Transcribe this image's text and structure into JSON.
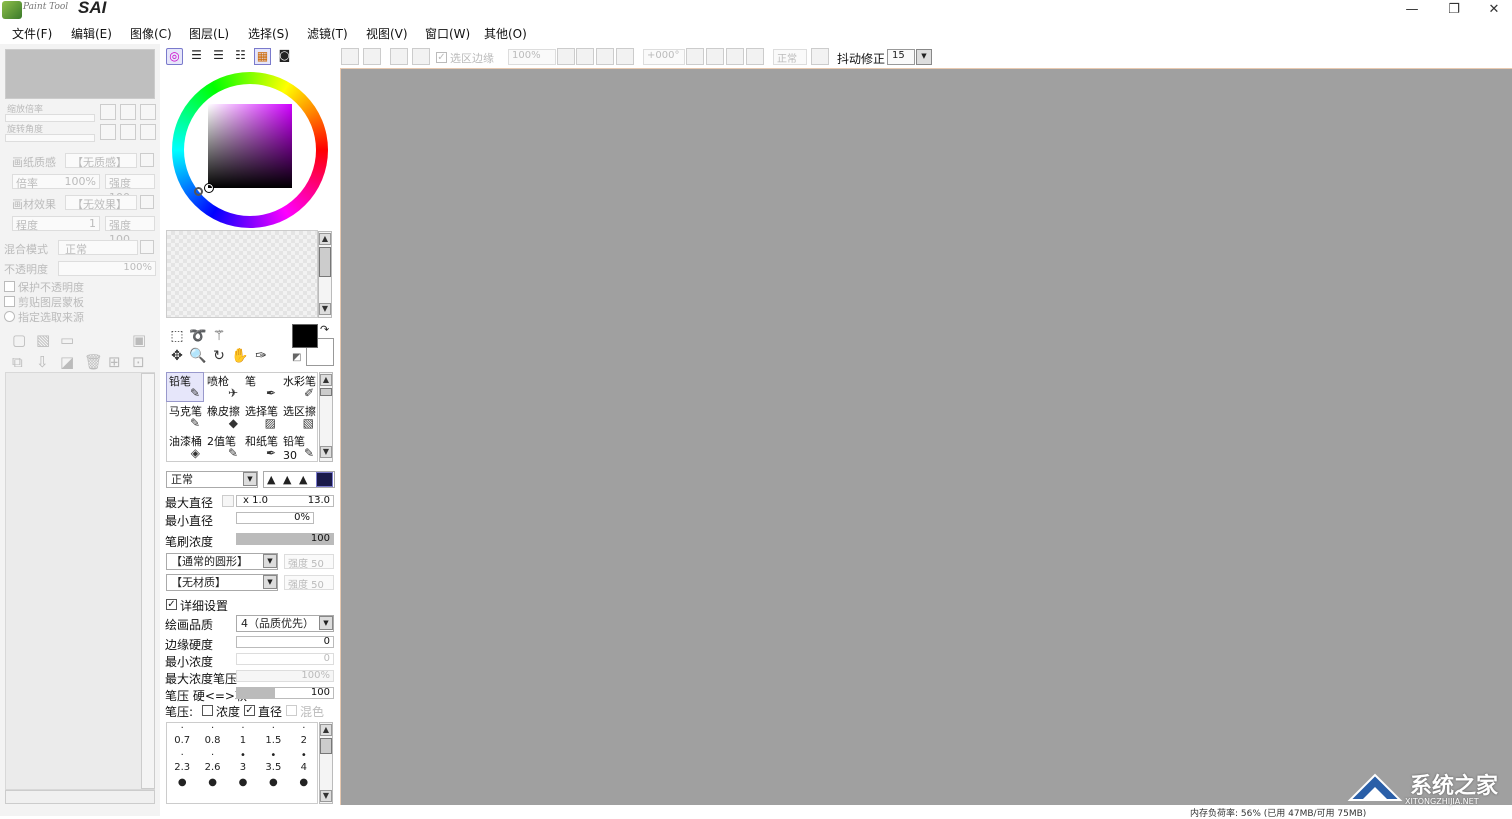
{
  "app": {
    "logo_text": "Paint Tool",
    "logo_brand": "SAI"
  },
  "window_controls": {
    "minimize": "—",
    "maximize": "❐",
    "close": "✕"
  },
  "menu": [
    "文件(F)",
    "编辑(E)",
    "图像(C)",
    "图层(L)",
    "选择(S)",
    "滤镜(T)",
    "视图(V)",
    "窗口(W)",
    "其他(O)"
  ],
  "left_panel": {
    "nav_zoom": "缩放倍率",
    "nav_rotate": "旋转角度",
    "paper_texture_label": "画纸质感",
    "paper_texture_value": "【无质感】",
    "magnify_label": "倍率",
    "magnify_value": "100%",
    "strength_label": "强度 100",
    "canvas_effect_label": "画材效果",
    "canvas_effect_value": "【无效果】",
    "width_label": "程度",
    "width_value": "1",
    "strength2_label": "强度 100",
    "blend_mode_label": "混合模式",
    "blend_mode_value": "正常",
    "opacity_label": "不透明度",
    "opacity_value": "100%",
    "chk_preserve_opacity": "保护不透明度",
    "chk_clip_group": "剪贴图层蒙板",
    "chk_selection_source": "指定选取来源"
  },
  "brush_grid": [
    {
      "label": "铅笔",
      "icon": "pencil-icon",
      "glyph": "✎",
      "selected": true
    },
    {
      "label": "喷枪",
      "icon": "airbrush-icon",
      "glyph": "✈",
      "selected": false
    },
    {
      "label": "笔",
      "icon": "pen-icon",
      "glyph": "✒",
      "selected": false
    },
    {
      "label": "水彩笔",
      "icon": "watercolor-icon",
      "glyph": "✐",
      "selected": false
    },
    {
      "label": "马克笔",
      "icon": "marker-icon",
      "glyph": "✎",
      "selected": false
    },
    {
      "label": "橡皮擦",
      "icon": "eraser-icon",
      "glyph": "◆",
      "selected": false
    },
    {
      "label": "选择笔",
      "icon": "select-pen-icon",
      "glyph": "▨",
      "selected": false
    },
    {
      "label": "选区擦",
      "icon": "select-erase-icon",
      "glyph": "▧",
      "selected": false
    },
    {
      "label": "油漆桶",
      "icon": "bucket-icon",
      "glyph": "◈",
      "selected": false
    },
    {
      "label": "2值笔",
      "icon": "binary-pen-icon",
      "glyph": "✎",
      "selected": false
    },
    {
      "label": "和纸笔",
      "icon": "washi-pen-icon",
      "glyph": "✒",
      "selected": false
    },
    {
      "label": "铅笔30",
      "icon": "pencil30-icon",
      "glyph": "✎",
      "selected": false
    }
  ],
  "brush_settings": {
    "mode": "正常",
    "max_diameter_label": "最大直径",
    "max_diameter_multiplier": "x 1.0",
    "max_diameter_value": "13.0",
    "min_diameter_label": "最小直径",
    "min_diameter_value": "0%",
    "density_label": "笔刷浓度",
    "density_value": "100",
    "density_fill": 1.0,
    "shape": "【通常的圆形】",
    "shape_strength": "强度  50",
    "texture": "【无材质】",
    "texture_strength": "强度  50",
    "detail_settings_label": "详细设置",
    "quality_label": "绘画品质",
    "quality_value": "4（品质优先）",
    "edge_hardness_label": "边缘硬度",
    "edge_hardness_value": "0",
    "min_density_label": "最小浓度",
    "min_density_value": "0",
    "max_density_pressure_label": "最大浓度笔压",
    "max_density_pressure_value": "100%",
    "pressure_label": "笔压  硬<=>软",
    "pressure_value": "100",
    "pressure_fill": 0.4,
    "pressure_opts_label": "笔压:",
    "pressure_density": "浓度",
    "pressure_diameter": "直径",
    "pressure_blend": "混色"
  },
  "brush_sizes": [
    {
      "label": "0.7",
      "dot": "·"
    },
    {
      "label": "0.8",
      "dot": "·"
    },
    {
      "label": "1",
      "dot": "·"
    },
    {
      "label": "1.5",
      "dot": "·"
    },
    {
      "label": "2",
      "dot": "·"
    },
    {
      "label": "2.3",
      "dot": "·"
    },
    {
      "label": "2.6",
      "dot": "·"
    },
    {
      "label": "3",
      "dot": "•"
    },
    {
      "label": "3.5",
      "dot": "•"
    },
    {
      "label": "4",
      "dot": "•"
    },
    {
      "label": "",
      "dot": "●"
    },
    {
      "label": "",
      "dot": "●"
    },
    {
      "label": "",
      "dot": "●"
    },
    {
      "label": "",
      "dot": "●"
    },
    {
      "label": "",
      "dot": "●"
    }
  ],
  "toolbar": {
    "selection_edge": "选区边缘",
    "zoom": "100%",
    "rotate": "+000°",
    "blend": "正常",
    "stabilizer_label": "抖动修正",
    "stabilizer_value": "15"
  },
  "status": {
    "memory": "内存负荷率: 56% (已用 47MB/可用 75MB)"
  },
  "watermark": {
    "title": "系统之家",
    "url": "XITONGZHIJIA.NET"
  },
  "colors": {
    "canvas_bg": "#a0a0a0",
    "accent_selected": "#e6e6fa",
    "fg_color": "#000000",
    "bg_color": "#ffffff"
  }
}
